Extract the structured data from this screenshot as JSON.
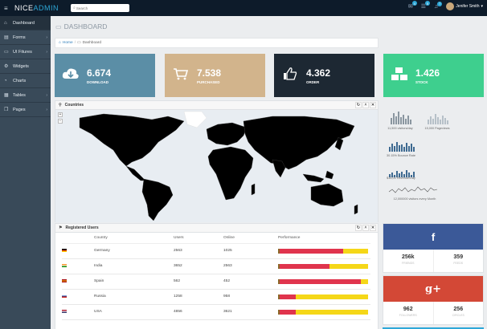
{
  "topbar": {
    "brand_part1": "NICE",
    "brand_part2": "ADMIN",
    "search_placeholder": "Search",
    "notifications": [
      {
        "icon": "envelope-icon",
        "count": "4"
      },
      {
        "icon": "tasks-icon",
        "count": "5"
      },
      {
        "icon": "bell-icon",
        "count": "7"
      }
    ],
    "user_name": "Jenifer Smith"
  },
  "sidebar": {
    "items": [
      {
        "label": "Dashboard",
        "icon": "home-icon",
        "arrow": false
      },
      {
        "label": "Forms",
        "icon": "document-icon",
        "arrow": true
      },
      {
        "label": "UI Fitures",
        "icon": "desktop-icon",
        "arrow": true
      },
      {
        "label": "Widgets",
        "icon": "gear-icon",
        "arrow": false
      },
      {
        "label": "Charts",
        "icon": "pie-chart-icon",
        "arrow": false
      },
      {
        "label": "Tables",
        "icon": "table-icon",
        "arrow": true
      },
      {
        "label": "Pages",
        "icon": "pages-icon",
        "arrow": true
      }
    ]
  },
  "page": {
    "title": "DASHBOARD",
    "breadcrumb_home": "Home",
    "breadcrumb_current": "Dashboard"
  },
  "stats": [
    {
      "value": "6.674",
      "label": "DOWNLOAD",
      "color": "#5b8ea6",
      "icon": "cloud-download-icon"
    },
    {
      "value": "7.538",
      "label": "PURCHASED",
      "color": "#d2b48c",
      "icon": "shopping-cart-icon"
    },
    {
      "value": "4.362",
      "label": "ORDER",
      "color": "#1d2833",
      "icon": "thumbs-up-icon"
    },
    {
      "value": "1.426",
      "label": "STOCK",
      "color": "#3ecf8e",
      "icon": "cubes-icon"
    }
  ],
  "countries_panel": {
    "title": "Countries"
  },
  "mini_stats": [
    "11,500 visitors/day",
    "15,000 Pageviews",
    "30.15% Bounce Rate",
    "$16,00 Revenue/Day",
    "12,000000 visitors every Month"
  ],
  "users_panel": {
    "title": "Registered Users",
    "columns": [
      "Country",
      "Users",
      "Online",
      "Performance"
    ],
    "rows": [
      {
        "country": "Germany",
        "users": "2563",
        "online": "1025",
        "performance": 0.72,
        "flag": [
          "#000000",
          "#dd0000",
          "#ffce00"
        ]
      },
      {
        "country": "India",
        "users": "3652",
        "online": "2563",
        "performance": 0.57,
        "flag": [
          "#ff9933",
          "#ffffff",
          "#138808"
        ]
      },
      {
        "country": "Spain",
        "users": "562",
        "online": "452",
        "performance": 0.92,
        "flag": [
          "#aa151b",
          "#f1bf00",
          "#aa151b"
        ]
      },
      {
        "country": "Russia",
        "users": "1258",
        "online": "958",
        "performance": 0.2,
        "flag": [
          "#ffffff",
          "#0039a6",
          "#d52b1e"
        ]
      },
      {
        "country": "USA",
        "users": "4856",
        "online": "3621",
        "performance": 0.2,
        "flag": [
          "#b22234",
          "#ffffff",
          "#3c3b6e"
        ]
      }
    ]
  },
  "social": [
    {
      "network": "facebook",
      "glyph": "f",
      "color": "#3b5998",
      "left_value": "256k",
      "left_label": "FRIENDS",
      "right_value": "359",
      "right_label": "FEEDS"
    },
    {
      "network": "google-plus",
      "glyph": "g+",
      "color": "#d34836",
      "left_value": "962",
      "left_label": "FOLLOWERS",
      "right_value": "256",
      "right_label": "CIRCLES"
    }
  ]
}
